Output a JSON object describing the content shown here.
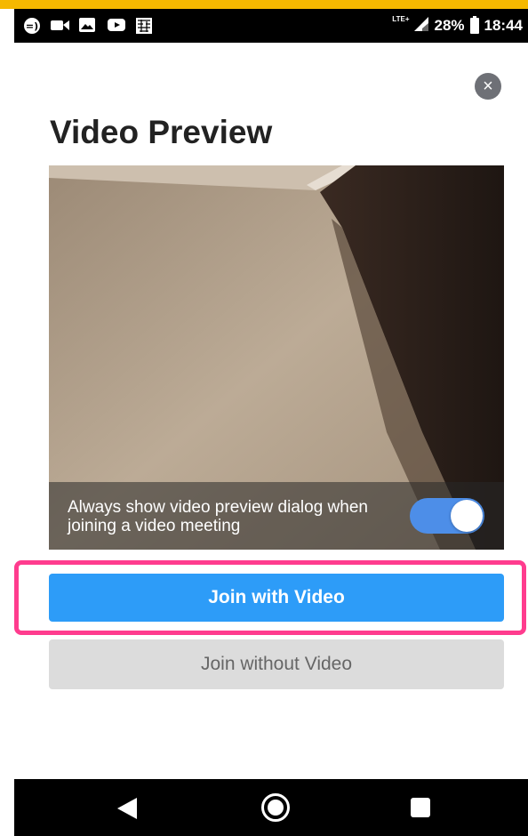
{
  "status_bar": {
    "network": "LTE+",
    "battery": "28%",
    "time": "18:44",
    "icons": [
      "chat-bubble-icon",
      "video-camera-icon",
      "image-icon",
      "youtube-icon",
      "pattern-app-icon",
      "signal-icon",
      "battery-icon"
    ]
  },
  "dialog": {
    "title": "Video Preview",
    "close_icon": "close-icon",
    "preview_toggle_label": "Always show video preview dialog when joining a video meeting",
    "preview_toggle_on": true
  },
  "buttons": {
    "join_with_video": "Join with Video",
    "join_without_video": "Join without Video"
  },
  "nav_bar": {
    "icons": [
      "back-icon",
      "home-icon",
      "recent-apps-icon"
    ]
  },
  "colors": {
    "accent_top": "#f5b800",
    "primary_button": "#2d9cf8",
    "secondary_button": "#dcdcdc",
    "toggle_on": "#4d8ee8",
    "highlight": "#ff3c8e"
  }
}
